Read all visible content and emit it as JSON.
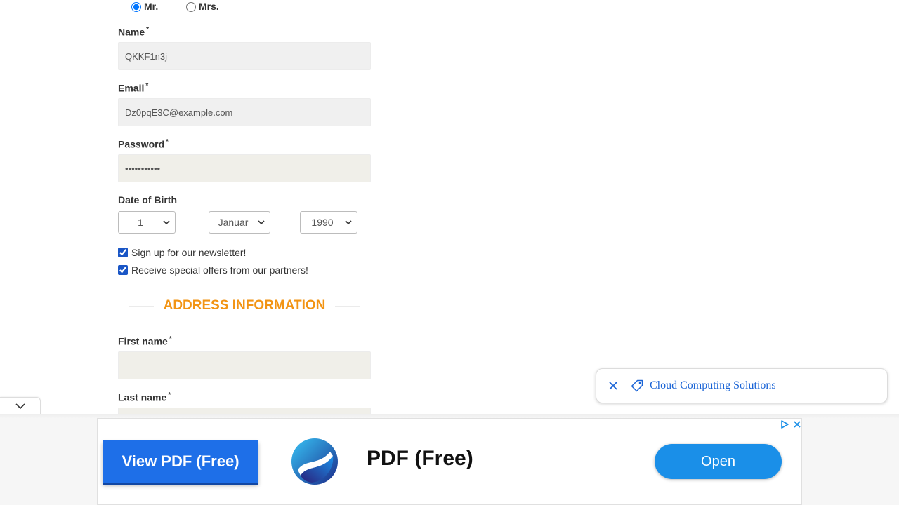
{
  "form": {
    "title_options": [
      {
        "label": "Mr.",
        "checked": true
      },
      {
        "label": "Mrs.",
        "checked": false
      }
    ],
    "name": {
      "label": "Name",
      "required_mark": "*",
      "value": "QKKF1n3j"
    },
    "email": {
      "label": "Email",
      "required_mark": "*",
      "value": "Dz0pqE3C@example.com"
    },
    "password": {
      "label": "Password",
      "required_mark": "*",
      "value": "•••••••••••"
    },
    "dob": {
      "label": "Date of Birth",
      "day": "1",
      "month": "Januar",
      "year": "1990"
    },
    "newsletter": {
      "label": "Sign up for our newsletter!",
      "checked": true
    },
    "offers": {
      "label": "Receive special offers from our partners!",
      "checked": true
    },
    "address_section_title": "ADDRESS INFORMATION",
    "first_name": {
      "label": "First name",
      "required_mark": "*",
      "value": ""
    },
    "last_name": {
      "label": "Last name",
      "required_mark": "*",
      "value": ""
    }
  },
  "search_chip": {
    "text": "Cloud Computing Solutions",
    "icons": [
      "close-icon",
      "tag-icon"
    ]
  },
  "ad": {
    "cta_label": "View PDF (Free)",
    "title": "PDF (Free)",
    "open_label": "Open",
    "icons": [
      "adchoices-icon",
      "close-icon",
      "app-logo"
    ]
  },
  "colors": {
    "accent_orange": "#f29414",
    "link_blue": "#1a64d6",
    "cta_blue": "#1e6fe8",
    "open_blue": "#1a8fe8"
  }
}
